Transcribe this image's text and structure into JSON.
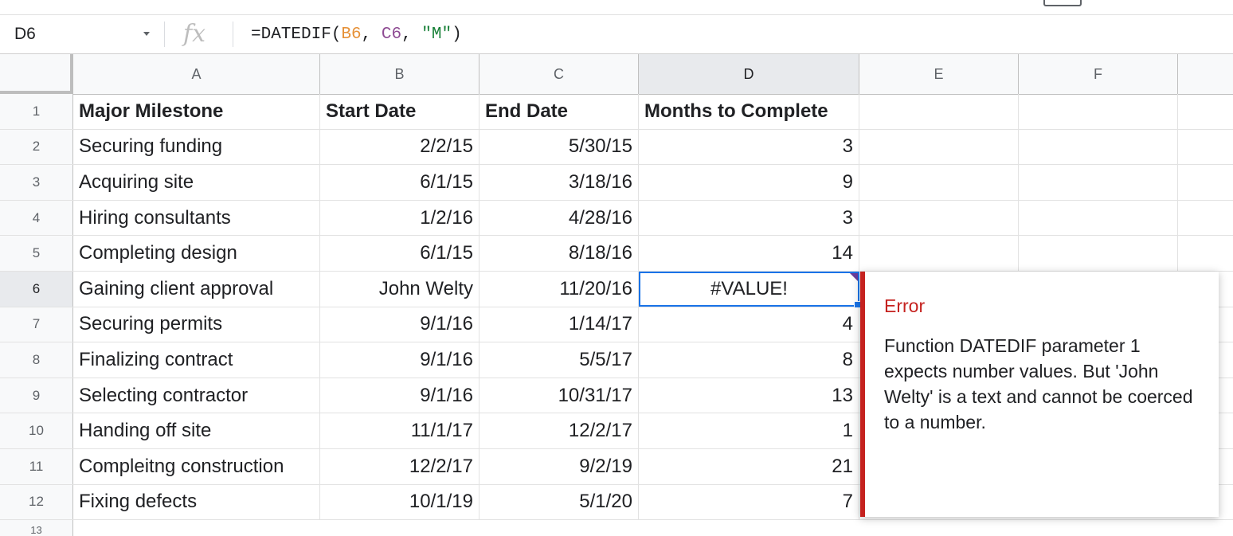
{
  "formula_bar": {
    "cell_ref": "D6",
    "fx_label": "fx",
    "formula_parts": [
      "=DATEDIF(",
      "B6",
      ", ",
      "C6",
      ", ",
      "\"M\"",
      ")"
    ]
  },
  "columns": [
    "A",
    "B",
    "C",
    "D",
    "E",
    "F"
  ],
  "rows": [
    {
      "num": "1",
      "a": "Major Milestone",
      "b": "Start Date",
      "c": "End Date",
      "d": "Months to Complete"
    },
    {
      "num": "2",
      "a": "Securing funding",
      "b": "2/2/15",
      "c": "5/30/15",
      "d": "3"
    },
    {
      "num": "3",
      "a": "Acquiring site",
      "b": "6/1/15",
      "c": "3/18/16",
      "d": "9"
    },
    {
      "num": "4",
      "a": "Hiring consultants",
      "b": "1/2/16",
      "c": "4/28/16",
      "d": "3"
    },
    {
      "num": "5",
      "a": "Completing design",
      "b": "6/1/15",
      "c": "8/18/16",
      "d": "14"
    },
    {
      "num": "6",
      "a": "Gaining client approval",
      "b": "John Welty",
      "c": "11/20/16",
      "d": "#VALUE!"
    },
    {
      "num": "7",
      "a": "Securing permits",
      "b": "9/1/16",
      "c": "1/14/17",
      "d": "4"
    },
    {
      "num": "8",
      "a": "Finalizing contract",
      "b": "9/1/16",
      "c": "5/5/17",
      "d": "8"
    },
    {
      "num": "9",
      "a": "Selecting contractor",
      "b": "9/1/16",
      "c": "10/31/17",
      "d": "13"
    },
    {
      "num": "10",
      "a": "Handing off site",
      "b": "11/1/17",
      "c": "12/2/17",
      "d": "1"
    },
    {
      "num": "11",
      "a": "Compleitng construction",
      "b": "12/2/17",
      "c": "9/2/19",
      "d": "21"
    },
    {
      "num": "12",
      "a": "Fixing defects",
      "b": "10/1/19",
      "c": "5/1/20",
      "d": "7"
    },
    {
      "num": "13",
      "a": "",
      "b": "",
      "c": "",
      "d": ""
    }
  ],
  "error": {
    "title": "Error",
    "message": "Function DATEDIF parameter 1 expects number values. But 'John Welty' is a text and cannot be coerced to a number."
  },
  "colors": {
    "selection": "#1a73e8",
    "error_red": "#c5221f",
    "ref_b": "#e69138",
    "ref_c": "#8e4b93",
    "string_green": "#188038"
  }
}
